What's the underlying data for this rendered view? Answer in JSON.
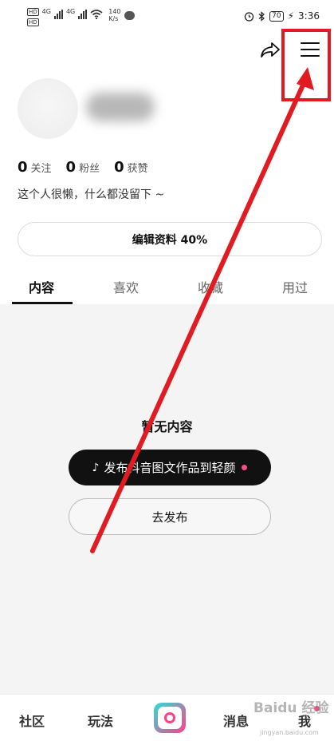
{
  "status_bar": {
    "hd_badge": "HD",
    "network_type": "4G",
    "speed_value": "140",
    "speed_unit": "K/s",
    "battery": "70",
    "time": "3:36"
  },
  "profile": {
    "stats": [
      {
        "count": "0",
        "label": "关注"
      },
      {
        "count": "0",
        "label": "粉丝"
      },
      {
        "count": "0",
        "label": "获赞"
      }
    ],
    "bio": "这个人很懒，什么都没留下 ~",
    "edit_button": "编辑资料 40%"
  },
  "tabs": [
    "内容",
    "喜欢",
    "收藏",
    "用过"
  ],
  "empty_state": {
    "title": "暂无内容",
    "publish_cta": "发布抖音图文作品到轻颜",
    "go_publish": "去发布"
  },
  "bottom_nav": {
    "items": [
      "社区",
      "玩法",
      "消息",
      "我"
    ]
  },
  "watermark": {
    "text": "Baidu 经验",
    "sub": "jingyan.baidu.com"
  },
  "colors": {
    "accent_pink": "#ff4d8d",
    "annotation_red": "#e11b22",
    "cta_black": "#111111"
  }
}
